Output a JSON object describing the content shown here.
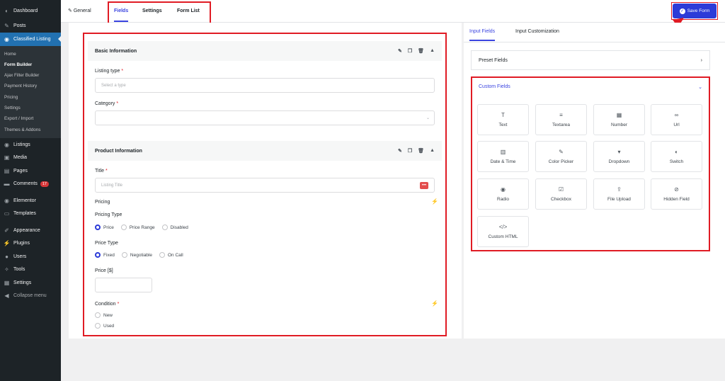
{
  "sidebar": {
    "items": [
      {
        "label": "Dashboard",
        "icon": "dashboard-icon"
      },
      {
        "label": "Posts",
        "icon": "pin-icon"
      },
      {
        "label": "Classified Listing",
        "icon": "location-icon",
        "active": true
      }
    ],
    "subitems": [
      "Home",
      "Form Builder",
      "Ajax Filter Builder",
      "Payment History",
      "Pricing",
      "Settings",
      "Export / Import",
      "Themes & Addons"
    ],
    "items2": [
      {
        "label": "Listings",
        "icon": "location-icon"
      },
      {
        "label": "Media",
        "icon": "media-icon"
      },
      {
        "label": "Pages",
        "icon": "pages-icon"
      },
      {
        "label": "Comments",
        "icon": "comment-icon",
        "badge": "17"
      },
      {
        "label": "Elementor",
        "icon": "elementor-icon"
      },
      {
        "label": "Templates",
        "icon": "folder-icon"
      },
      {
        "label": "Appearance",
        "icon": "brush-icon"
      },
      {
        "label": "Plugins",
        "icon": "plug-icon"
      },
      {
        "label": "Users",
        "icon": "user-icon"
      },
      {
        "label": "Tools",
        "icon": "wrench-icon"
      },
      {
        "label": "Settings",
        "icon": "settings-icon"
      },
      {
        "label": "Collapse menu",
        "icon": "collapse-icon"
      }
    ]
  },
  "topbar": {
    "general": "General",
    "tabs": [
      "Fields",
      "Settings",
      "Form List"
    ],
    "save": "Save Form"
  },
  "basic": {
    "title": "Basic Information",
    "listing_type_label": "Listing type",
    "listing_type_placeholder": "Select a type",
    "category_label": "Category"
  },
  "product": {
    "title": "Product Information",
    "title_label": "Title",
    "title_placeholder": "Listing Title",
    "pricing": "Pricing",
    "pricing_type": "Pricing Type",
    "pricing_type_options": [
      "Price",
      "Price Range",
      "Disabled"
    ],
    "price_type": "Price Type",
    "price_type_options": [
      "Fixed",
      "Negotiable",
      "On Call"
    ],
    "price_label": "Price [$]",
    "condition": "Condition",
    "condition_options": [
      "New",
      "Used"
    ]
  },
  "right": {
    "tabs": [
      "Input Fields",
      "Input Customization"
    ],
    "preset": "Preset Fields",
    "custom": "Custom Fields",
    "fields": [
      {
        "label": "Text",
        "icon": "text-icon"
      },
      {
        "label": "Textarea",
        "icon": "textarea-icon"
      },
      {
        "label": "Number",
        "icon": "number-icon"
      },
      {
        "label": "Url",
        "icon": "link-icon"
      },
      {
        "label": "Date & Time",
        "icon": "calendar-icon"
      },
      {
        "label": "Color Picker",
        "icon": "color-picker-icon"
      },
      {
        "label": "Dropdown",
        "icon": "dropdown-icon"
      },
      {
        "label": "Switch",
        "icon": "switch-icon"
      },
      {
        "label": "Radio",
        "icon": "radio-icon"
      },
      {
        "label": "Checkbox",
        "icon": "checkbox-icon"
      },
      {
        "label": "File Upload",
        "icon": "upload-icon"
      },
      {
        "label": "Hidden Field",
        "icon": "hidden-icon"
      },
      {
        "label": "Custom HTML",
        "icon": "code-icon"
      }
    ]
  },
  "colors": {
    "accent": "#3b45e0",
    "highlight": "#e01b24",
    "sidebar": "#1d2327"
  }
}
